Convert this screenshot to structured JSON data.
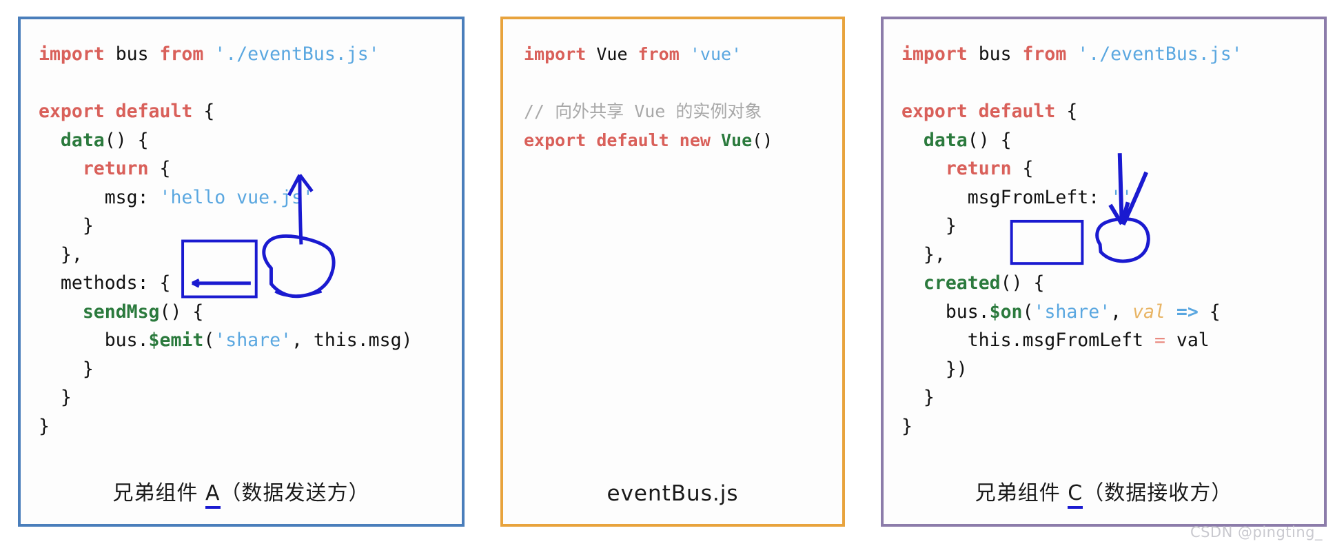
{
  "panels": [
    {
      "id": "component-a",
      "border_color": "#4a7ebb",
      "caption": "兄弟组件 A（数据发送方）",
      "caption_underline_char": "A",
      "code_lines": [
        [
          {
            "t": "import ",
            "c": "kw"
          },
          {
            "t": "bus ",
            "c": "pl"
          },
          {
            "t": "from ",
            "c": "kw"
          },
          {
            "t": "'./eventBus.js'",
            "c": "str"
          }
        ],
        [],
        [
          {
            "t": "export default ",
            "c": "kw"
          },
          {
            "t": "{",
            "c": "pl"
          }
        ],
        [
          {
            "t": "  ",
            "c": "pl"
          },
          {
            "t": "data",
            "c": "fn"
          },
          {
            "t": "() {",
            "c": "pl"
          }
        ],
        [
          {
            "t": "    ",
            "c": "pl"
          },
          {
            "t": "return ",
            "c": "kw"
          },
          {
            "t": "{",
            "c": "pl"
          }
        ],
        [
          {
            "t": "      msg: ",
            "c": "pl"
          },
          {
            "t": "'hello vue.js'",
            "c": "str"
          }
        ],
        [
          {
            "t": "    }",
            "c": "pl"
          }
        ],
        [
          {
            "t": "  },",
            "c": "pl"
          }
        ],
        [
          {
            "t": "  methods: {",
            "c": "pl"
          }
        ],
        [
          {
            "t": "    ",
            "c": "pl"
          },
          {
            "t": "sendMsg",
            "c": "fn"
          },
          {
            "t": "() {",
            "c": "pl"
          }
        ],
        [
          {
            "t": "      bus.",
            "c": "pl"
          },
          {
            "t": "$emit",
            "c": "fn"
          },
          {
            "t": "(",
            "c": "pl"
          },
          {
            "t": "'share'",
            "c": "str"
          },
          {
            "t": ", this.msg)",
            "c": "pl"
          }
        ],
        [
          {
            "t": "    }",
            "c": "pl"
          }
        ],
        [
          {
            "t": "  }",
            "c": "pl"
          }
        ],
        [
          {
            "t": "}",
            "c": "pl"
          }
        ]
      ],
      "annotations": [
        {
          "kind": "rect-box",
          "label": "share-highlight-box",
          "target": "'share'"
        },
        {
          "kind": "underline-arrow",
          "label": "share-underline-arrow"
        },
        {
          "kind": "circle",
          "label": "this-msg-circle",
          "target": "this.msg"
        },
        {
          "kind": "arrow-up",
          "label": "this-msg-up-arrow"
        }
      ]
    },
    {
      "id": "event-bus",
      "border_color": "#e8a33d",
      "caption": "eventBus.js",
      "code_lines": [
        [
          {
            "t": "import ",
            "c": "kw"
          },
          {
            "t": "Vue ",
            "c": "pl"
          },
          {
            "t": "from ",
            "c": "kw"
          },
          {
            "t": "'vue'",
            "c": "str"
          }
        ],
        [],
        [
          {
            "t": "// 向外共享 Vue 的实例对象",
            "c": "cmt"
          }
        ],
        [
          {
            "t": "export default new ",
            "c": "kw"
          },
          {
            "t": "Vue",
            "c": "fn"
          },
          {
            "t": "()",
            "c": "pl"
          }
        ]
      ],
      "annotations": []
    },
    {
      "id": "component-c",
      "border_color": "#8c7caa",
      "caption": "兄弟组件 C（数据接收方）",
      "caption_underline_char": "C",
      "code_lines": [
        [
          {
            "t": "import ",
            "c": "kw"
          },
          {
            "t": "bus ",
            "c": "pl"
          },
          {
            "t": "from ",
            "c": "kw"
          },
          {
            "t": "'./eventBus.js'",
            "c": "str"
          }
        ],
        [],
        [
          {
            "t": "export default ",
            "c": "kw"
          },
          {
            "t": "{",
            "c": "pl"
          }
        ],
        [
          {
            "t": "  ",
            "c": "pl"
          },
          {
            "t": "data",
            "c": "fn"
          },
          {
            "t": "() {",
            "c": "pl"
          }
        ],
        [
          {
            "t": "    ",
            "c": "pl"
          },
          {
            "t": "return ",
            "c": "kw"
          },
          {
            "t": "{",
            "c": "pl"
          }
        ],
        [
          {
            "t": "      msgFromLeft: ",
            "c": "pl"
          },
          {
            "t": "''",
            "c": "str"
          }
        ],
        [
          {
            "t": "    }",
            "c": "pl"
          }
        ],
        [
          {
            "t": "  },",
            "c": "pl"
          }
        ],
        [
          {
            "t": "  ",
            "c": "pl"
          },
          {
            "t": "created",
            "c": "fn"
          },
          {
            "t": "() {",
            "c": "pl"
          }
        ],
        [
          {
            "t": "    bus.",
            "c": "pl"
          },
          {
            "t": "$on",
            "c": "fn"
          },
          {
            "t": "(",
            "c": "pl"
          },
          {
            "t": "'share'",
            "c": "str"
          },
          {
            "t": ", ",
            "c": "pl"
          },
          {
            "t": "val",
            "c": "param"
          },
          {
            "t": " => ",
            "c": "arw"
          },
          {
            "t": "{",
            "c": "pl"
          }
        ],
        [
          {
            "t": "      this.msgFromLeft ",
            "c": "pl"
          },
          {
            "t": "=",
            "c": "op"
          },
          {
            "t": " val",
            "c": "pl"
          }
        ],
        [
          {
            "t": "    })",
            "c": "pl"
          }
        ],
        [
          {
            "t": "  }",
            "c": "pl"
          }
        ],
        [
          {
            "t": "}",
            "c": "pl"
          }
        ]
      ],
      "annotations": [
        {
          "kind": "rect-box",
          "label": "share-highlight-box",
          "target": "'share'"
        },
        {
          "kind": "circle",
          "label": "val-circle",
          "target": "val"
        },
        {
          "kind": "arrow-down",
          "label": "val-down-arrow-1"
        },
        {
          "kind": "arrow-down",
          "label": "val-down-arrow-2"
        }
      ]
    }
  ],
  "watermark": "CSDN @pingting_",
  "colors": {
    "keyword": "#d9605a",
    "function": "#2b7a3d",
    "string": "#5aa7e0",
    "comment": "#a8a8a8",
    "operator": "#e98a80",
    "annotation": "#1a1ad0",
    "param": "#e8b464",
    "panel_a_border": "#4a7ebb",
    "panel_b_border": "#e8a33d",
    "panel_c_border": "#8c7caa"
  }
}
